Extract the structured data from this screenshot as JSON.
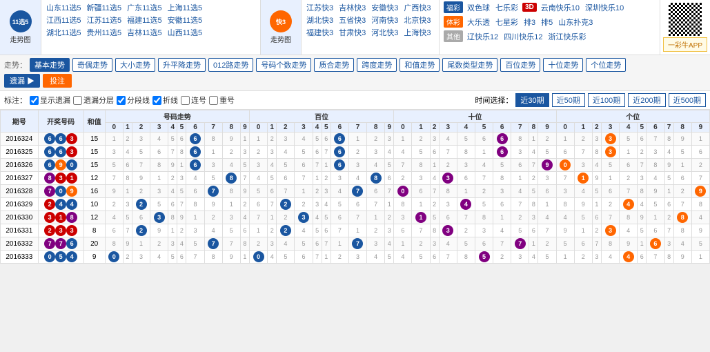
{
  "logo": {
    "text": "11选5",
    "sub": "走势图"
  },
  "lottery_rows": [
    [
      "山东11选5",
      "新疆11选5",
      "广东11选5",
      "上海11选5"
    ],
    [
      "江西11选5",
      "江苏11选5",
      "福建11选5",
      "安徽11选5"
    ],
    [
      "湖北11选5",
      "贵州11选5",
      "吉林11选5",
      "山西11选5"
    ]
  ],
  "quick3": {
    "text": "快3",
    "sub": "走势图"
  },
  "right_links_row1": [
    "江苏快3",
    "吉林快3",
    "安徽快3",
    "广西快3"
  ],
  "right_links_row2": [
    "湖北快3",
    "五省快3",
    "河南快3",
    "北京快3"
  ],
  "right_links_row3": [
    "福建快3",
    "甘肃快3",
    "河北快3",
    "上海快3"
  ],
  "tags": {
    "caipiao": "福彩",
    "ticai": "体彩",
    "other": "其他",
    "label3d": "3D"
  },
  "caipiao_links": [
    "双色球",
    "七乐彩",
    "3D",
    "云南快乐10",
    "深圳快乐10"
  ],
  "ticai_links": [
    "大乐透",
    "七星彩",
    "排3",
    "排5",
    "山东扑克3"
  ],
  "other_links": [
    "辽快乐12",
    "四川快乐12",
    "浙江快乐彩"
  ],
  "toolbar": {
    "trend_label": "走势：",
    "tabs": [
      "基本走势",
      "奇偶走势",
      "大小走势",
      "升平降走势",
      "012路走势",
      "号码个数走势",
      "质合走势",
      "跨度走势",
      "和值走势",
      "尾数类型走势",
      "百位走势",
      "十位走势",
      "个位走势"
    ],
    "miss_btn": "遗漏",
    "bet_btn": "投注"
  },
  "filter": {
    "label": "标注：",
    "checks": [
      "显示遗漏",
      "遗漏分层",
      "分段线",
      "折线",
      "连号",
      "重号"
    ],
    "time_label": "时间选择：",
    "periods": [
      "近30期",
      "近50期",
      "近100期",
      "近200期",
      "近500期"
    ]
  },
  "table": {
    "headers": [
      "期号",
      "开奖号码",
      "和值",
      "号码走势",
      "百位",
      "十位",
      "个位"
    ],
    "sub_headers_trend": [
      "0",
      "1",
      "2",
      "3",
      "4",
      "5",
      "6",
      "7",
      "8",
      "9"
    ],
    "sub_headers_bai": [
      "0",
      "1",
      "2",
      "3",
      "4",
      "5",
      "6",
      "7",
      "8",
      "9"
    ],
    "sub_headers_shi": [
      "0",
      "1",
      "2",
      "3",
      "4",
      "5",
      "6",
      "7",
      "8",
      "9"
    ],
    "sub_headers_ge": [
      "0",
      "1",
      "2",
      "3",
      "4",
      "5",
      "6",
      "7",
      "8",
      "9"
    ],
    "rows": [
      {
        "period": "2016324",
        "nums": [
          "6",
          "6",
          "3"
        ],
        "sum": "15",
        "trend_highlight": 3,
        "bai": 6,
        "shi": 6,
        "ge": 3
      },
      {
        "period": "2016325",
        "nums": [
          "6",
          "6",
          "3"
        ],
        "sum": "15",
        "trend_highlight": 3,
        "bai": 6,
        "shi": 6,
        "ge": 3
      },
      {
        "period": "2016326",
        "nums": [
          "6",
          "9",
          "0"
        ],
        "sum": "15",
        "trend_highlight": 0,
        "bai": 6,
        "shi": 9,
        "ge": 0
      },
      {
        "period": "2016327",
        "nums": [
          "8",
          "3",
          "1"
        ],
        "sum": "12",
        "trend_highlight": 1,
        "bai": 8,
        "shi": 3,
        "ge": 1
      },
      {
        "period": "2016328",
        "nums": [
          "7",
          "0",
          "9"
        ],
        "sum": "16",
        "trend_highlight": 0,
        "bai": 7,
        "shi": 0,
        "ge": 9
      },
      {
        "period": "2016329",
        "nums": [
          "2",
          "4",
          "4"
        ],
        "sum": "10",
        "trend_highlight": 2,
        "bai": 2,
        "shi": 4,
        "ge": 4
      },
      {
        "period": "2016330",
        "nums": [
          "3",
          "1",
          "8"
        ],
        "sum": "12",
        "trend_highlight": 1,
        "bai": 3,
        "shi": 1,
        "ge": 8
      },
      {
        "period": "2016331",
        "nums": [
          "2",
          "3",
          "3"
        ],
        "sum": "8",
        "trend_highlight": 3,
        "bai": 2,
        "shi": 3,
        "ge": 3
      },
      {
        "period": "2016332",
        "nums": [
          "7",
          "7",
          "6"
        ],
        "sum": "20",
        "trend_highlight": 7,
        "bai": 7,
        "shi": 7,
        "ge": 6
      },
      {
        "period": "2016333",
        "nums": [
          "0",
          "5",
          "4"
        ],
        "sum": "9",
        "trend_highlight": 0,
        "bai": 0,
        "shi": 5,
        "ge": 4
      }
    ]
  },
  "app_banner": "一彩牛APP"
}
